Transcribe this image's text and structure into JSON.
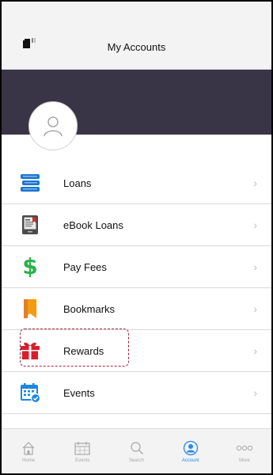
{
  "header": {
    "title": "My Accounts"
  },
  "menu": [
    {
      "label": "Loans",
      "icon": "books-icon",
      "chevron": "›"
    },
    {
      "label": "eBook Loans",
      "icon": "ereader-icon",
      "chevron": "›"
    },
    {
      "label": "Pay Fees",
      "icon": "dollar-icon",
      "chevron": "›"
    },
    {
      "label": "Bookmarks",
      "icon": "bookmark-icon",
      "chevron": "›"
    },
    {
      "label": "Rewards",
      "icon": "gift-icon",
      "chevron": "›"
    },
    {
      "label": "Events",
      "icon": "calendar-icon",
      "chevron": "›"
    }
  ],
  "tabs": [
    {
      "label": "Home",
      "icon": "home-icon",
      "active": false
    },
    {
      "label": "Events",
      "icon": "calendar-icon",
      "active": false
    },
    {
      "label": "Search",
      "icon": "search-icon",
      "active": false
    },
    {
      "label": "Account",
      "icon": "account-icon",
      "active": true
    },
    {
      "label": "More",
      "icon": "more-icon",
      "active": false
    }
  ],
  "colors": {
    "banner": "#3a3546",
    "accent": "#2a8ae6",
    "highlight": "#a32b3a"
  }
}
